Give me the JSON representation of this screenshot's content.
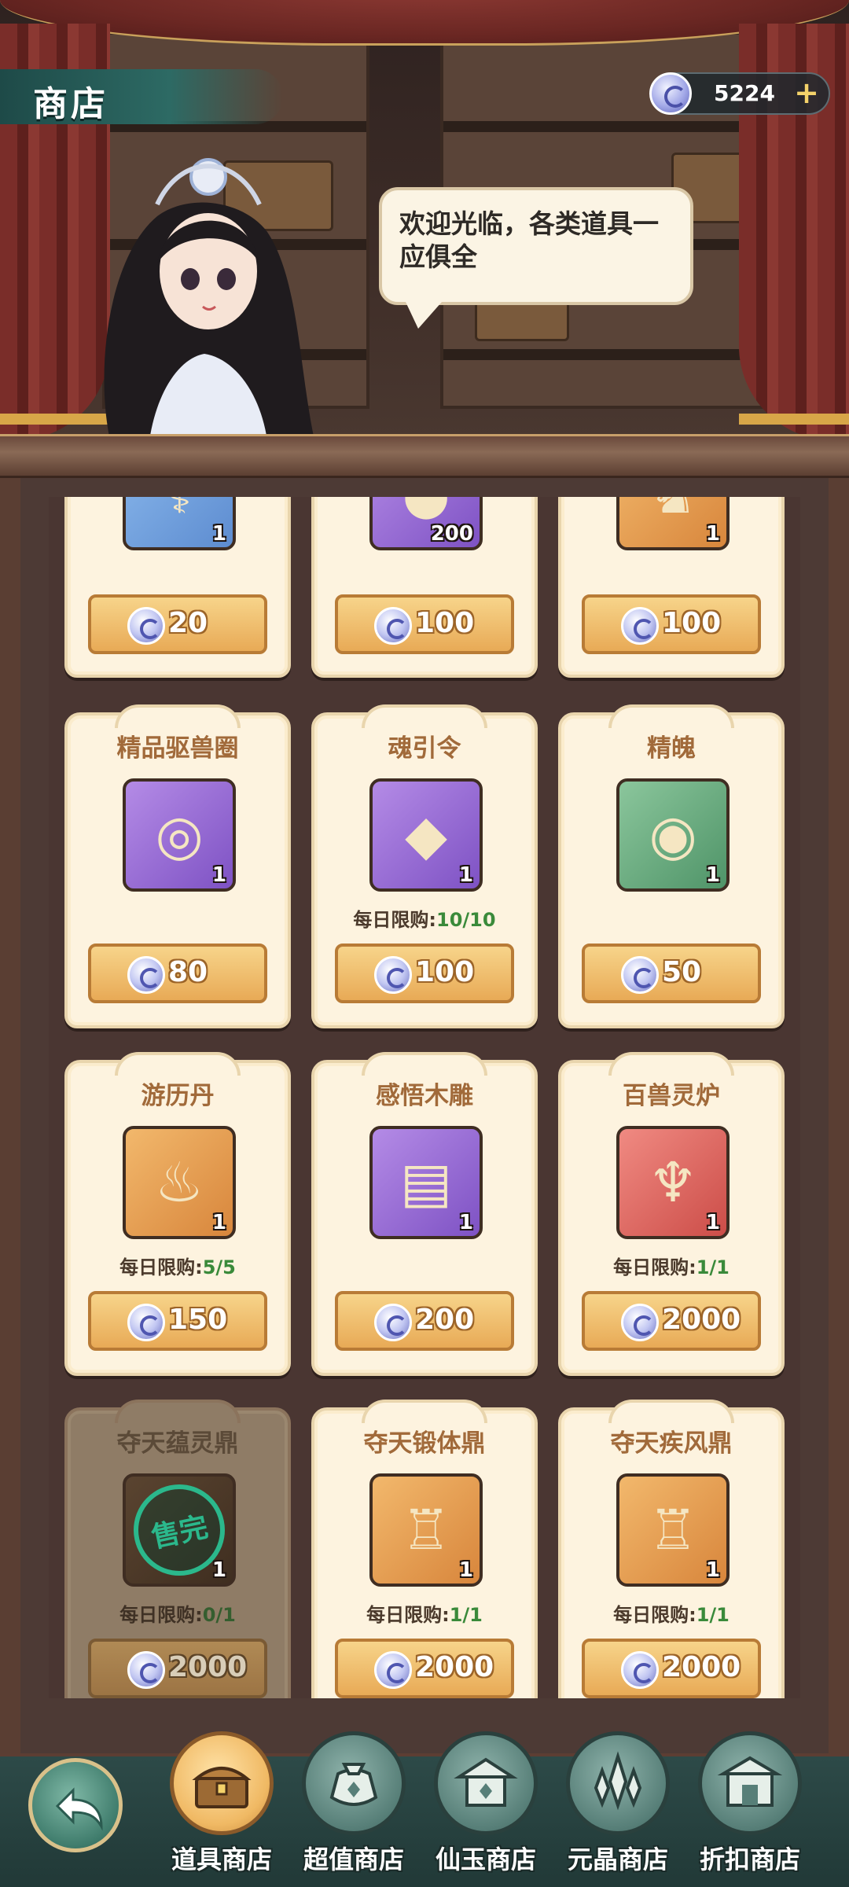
{
  "header": {
    "title": "商店",
    "currency_value": "5224",
    "add_label": "+"
  },
  "npc": {
    "speech": "欢迎光临，各类道具一应俱全"
  },
  "shop": {
    "items": [
      {
        "name": "",
        "count": "1",
        "price": "20",
        "rarity": "blue",
        "icon": "serpent-icon"
      },
      {
        "name": "",
        "count": "200",
        "price": "100",
        "rarity": "purple",
        "icon": "orb-icon"
      },
      {
        "name": "",
        "count": "1",
        "price": "100",
        "rarity": "orange",
        "icon": "beast-icon"
      },
      {
        "name": "精品驱兽圈",
        "count": "1",
        "price": "80",
        "rarity": "purple",
        "icon": "ring-icon"
      },
      {
        "name": "魂引令",
        "count": "1",
        "price": "100",
        "limit_label": "每日限购:",
        "limit": "10/10",
        "rarity": "purple",
        "icon": "token-icon"
      },
      {
        "name": "精魄",
        "count": "1",
        "price": "50",
        "rarity": "green",
        "icon": "golden-orb-icon"
      },
      {
        "name": "游历丹",
        "count": "1",
        "price": "150",
        "limit_label": "每日限购:",
        "limit": "5/5",
        "rarity": "orange",
        "icon": "crystal-ball-icon"
      },
      {
        "name": "感悟木雕",
        "count": "1",
        "price": "200",
        "rarity": "purple",
        "icon": "carving-icon"
      },
      {
        "name": "百兽灵炉",
        "count": "1",
        "price": "2000",
        "limit_label": "每日限购:",
        "limit": "1/1",
        "rarity": "red",
        "icon": "furnace-icon"
      },
      {
        "name": "夺天蕴灵鼎",
        "count": "1",
        "price": "2000",
        "limit_label": "每日限购:",
        "limit": "0/1",
        "rarity": "dark",
        "icon": "cauldron-icon",
        "sold_out": "售完"
      },
      {
        "name": "夺天锻体鼎",
        "count": "1",
        "price": "2000",
        "limit_label": "每日限购:",
        "limit": "1/1",
        "rarity": "orange",
        "icon": "cauldron-icon"
      },
      {
        "name": "夺天疾风鼎",
        "count": "1",
        "price": "2000",
        "limit_label": "每日限购:",
        "limit": "1/1",
        "rarity": "orange",
        "icon": "cauldron-icon"
      }
    ]
  },
  "nav": {
    "tabs": [
      {
        "label": "道具商店",
        "icon": "treasure-chest-icon",
        "active": true
      },
      {
        "label": "超值商店",
        "icon": "money-bag-icon"
      },
      {
        "label": "仙玉商店",
        "icon": "pavilion-icon"
      },
      {
        "label": "元晶商店",
        "icon": "crystal-icon"
      },
      {
        "label": "折扣商店",
        "icon": "shop-building-icon"
      }
    ]
  },
  "colors": {
    "accent_gold": "#e8aa56",
    "limit_green": "#3a8a3a",
    "card_bg": "#fdf3df",
    "nav_bg": "#2d4a48"
  }
}
